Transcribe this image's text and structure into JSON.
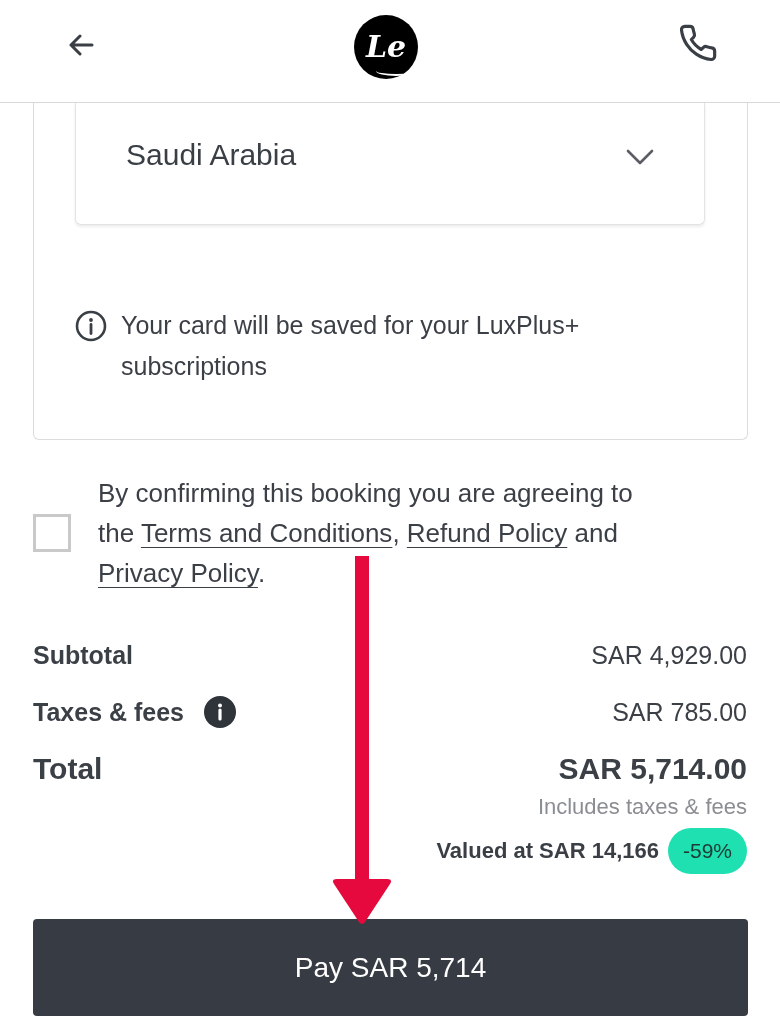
{
  "header": {
    "logo_text": "Le"
  },
  "payment_card": {
    "country_select": {
      "value": "Saudi Arabia"
    },
    "note": "Your card will be saved for your LuxPlus+ subscriptions"
  },
  "consent": {
    "checked": false,
    "parts": [
      {
        "kind": "text",
        "text": "By confirming this booking you are agreeing to the "
      },
      {
        "kind": "link",
        "text": "Terms and Conditions"
      },
      {
        "kind": "text",
        "text": ", "
      },
      {
        "kind": "link",
        "text": "Refund Policy"
      },
      {
        "kind": "text",
        "text": " and "
      },
      {
        "kind": "link",
        "text": "Privacy Policy"
      },
      {
        "kind": "text",
        "text": "."
      }
    ]
  },
  "summary": {
    "rows": [
      {
        "kind": "line",
        "label": "Subtotal",
        "value": "SAR 4,929.00",
        "info": false
      },
      {
        "kind": "line",
        "label": "Taxes & fees",
        "value": "SAR 785.00",
        "info": true
      },
      {
        "kind": "total",
        "label": "Total",
        "value": "SAR 5,714.00",
        "info": false
      }
    ],
    "total_note": "Includes taxes & fees",
    "valued_at": "Valued at SAR 14,166",
    "discount": "-59%"
  },
  "pay_button": {
    "label": "Pay SAR 5,714"
  },
  "annotation": {
    "kind": "arrow"
  }
}
